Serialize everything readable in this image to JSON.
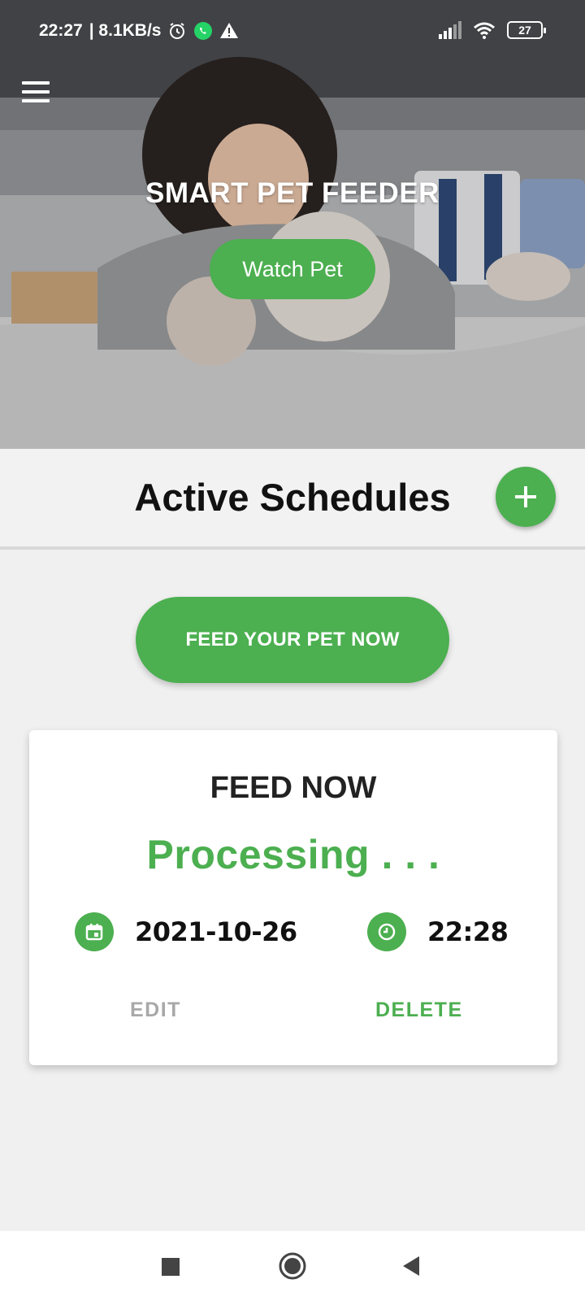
{
  "status_bar": {
    "time": "22:27",
    "net_speed": "| 8.1KB/s",
    "battery": "27",
    "icons": [
      "alarm-icon",
      "whatsapp-icon",
      "warning-icon",
      "signal-icon",
      "wifi-icon",
      "battery-icon"
    ]
  },
  "hero": {
    "title": "SMART PET FEEDER",
    "watch_button": "Watch Pet"
  },
  "schedules": {
    "title": "Active Schedules",
    "add_icon": "plus-icon"
  },
  "feed_now_button": "FEED YOUR PET NOW",
  "card": {
    "title": "FEED NOW",
    "status": "Processing . . .",
    "date": "2021-10-26",
    "time": "22:28",
    "edit": "EDIT",
    "delete": "DELETE"
  },
  "nav": {
    "icons": [
      "recents-icon",
      "home-icon",
      "back-icon"
    ]
  },
  "colors": {
    "accent": "#4caf50",
    "muted": "#a8a8a8"
  }
}
